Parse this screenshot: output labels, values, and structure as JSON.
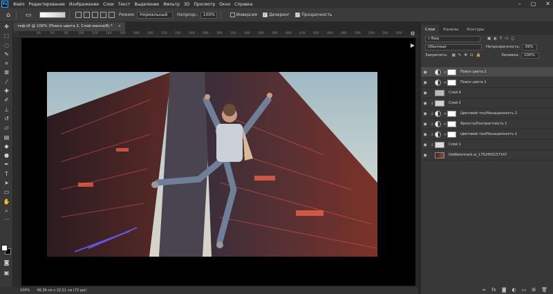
{
  "menubar": {
    "app_icon": "Ps",
    "items": [
      "Файл",
      "Редактирование",
      "Изображение",
      "Слои",
      "Текст",
      "Выделение",
      "Фильтр",
      "3D",
      "Просмотр",
      "Окно",
      "Справка"
    ],
    "controls": [
      "minimize-icon",
      "maximize-icon",
      "close-icon"
    ]
  },
  "options": {
    "mode_label": "Режим:",
    "mode_value": "Нормальный",
    "opacity_label": "Непрозр.:",
    "opacity_value": "100%",
    "inverse_label": "Инверсия",
    "dither_label": "Дизеринг",
    "transparency_label": "Прозрачность"
  },
  "document": {
    "tab_title": "тиф.tif @ 100% (Поиск цвета 2, Слой-маска/8) *",
    "close": "×",
    "ruler_marks": [
      "",
      "40",
      "60",
      "80",
      "100",
      "120",
      "140",
      "160",
      "180",
      "200",
      "220",
      "240",
      "260",
      "280",
      "300",
      "320",
      "340",
      "360",
      "380",
      "400",
      "420",
      "440",
      "460",
      "480",
      "500",
      "520",
      "540",
      "560"
    ]
  },
  "status": {
    "zoom": "100%",
    "size": "46,39 см x 22,51 см (72 ppi)"
  },
  "layers_panel": {
    "tabs": [
      "Слои",
      "Каналы",
      "Контуры"
    ],
    "filter": "Вид",
    "blend_mode": "Обычные",
    "opacity_label": "Непрозрачность:",
    "opacity_value": "39%",
    "lock_label": "Закрепить:",
    "fill_label": "Заливка:",
    "fill_value": "100%",
    "layers": [
      {
        "name": "Поиск цвета 2",
        "selected": true
      },
      {
        "name": "Поиск цвета 1"
      },
      {
        "name": "Слой 4"
      },
      {
        "name": "Слой 2"
      },
      {
        "name": "Цветовой тон/Насыщенность 2"
      },
      {
        "name": "Яркость/Контрастность 1"
      },
      {
        "name": "Цветовой тон/Насыщенность 1"
      },
      {
        "name": "Слой 1"
      },
      {
        "name": "DeWatermark.ai_1752493157147"
      }
    ]
  }
}
